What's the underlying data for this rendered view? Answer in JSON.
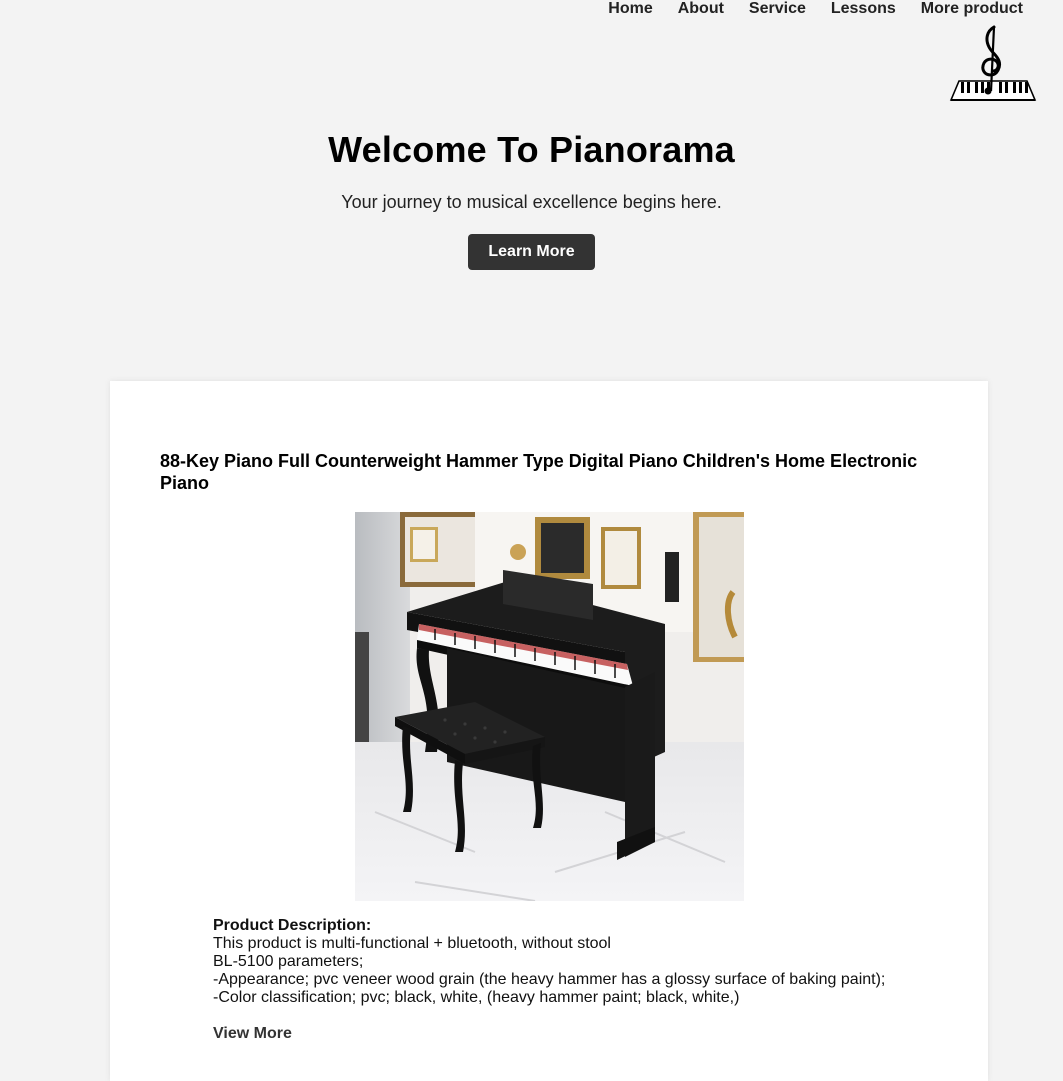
{
  "nav": {
    "items": [
      {
        "label": "Home"
      },
      {
        "label": "About"
      },
      {
        "label": "Service"
      },
      {
        "label": "Lessons"
      },
      {
        "label": "More product"
      }
    ]
  },
  "logo": {
    "icon": "treble-clef-piano-logo-icon"
  },
  "hero": {
    "title": "Welcome To Pianorama",
    "subtitle": "Your journey to musical excellence begins here.",
    "button_label": "Learn More"
  },
  "product": {
    "title": "88-Key Piano Full Counterweight Hammer Type Digital Piano Children's Home Electronic Piano",
    "image_icon": "digital-piano-image",
    "description_label": "Product Description:",
    "description_lines": [
      "This product is multi-functional + bluetooth, without stool",
      "BL-5100 parameters;",
      "-Appearance; pvc veneer wood grain (the heavy hammer has a glossy surface of baking paint);",
      "-Color classification; pvc; black, white, (heavy hammer paint; black, white,)"
    ],
    "view_more_label": "View More"
  },
  "colors": {
    "background": "#f3f3f3",
    "button": "#333333",
    "card": "#ffffff"
  }
}
